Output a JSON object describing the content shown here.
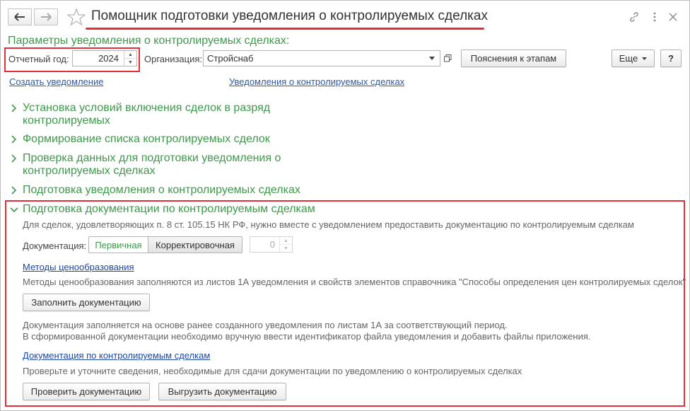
{
  "header": {
    "title": "Помощник подготовки уведомления о контролируемых сделках",
    "back_icon": "arrow-left-icon",
    "forward_icon": "arrow-right-icon",
    "favorite_icon": "star-icon",
    "link_icon": "link-icon",
    "more_icon": "ellipsis-vertical-icon",
    "close_icon": "close-icon"
  },
  "params": {
    "section_title": "Параметры уведомления о контролируемых сделках:",
    "year_label": "Отчетный год:",
    "year_value": "2024",
    "org_label": "Организация:",
    "org_value": "Стройснаб",
    "explain_button": "Пояснения к этапам",
    "more_button": "Еще",
    "help_button": "?"
  },
  "links": {
    "create": "Создать уведомление",
    "notifications": "Уведомления о контролируемых сделках"
  },
  "steps": [
    {
      "line1": "Установка условий включения сделок в разряд",
      "line2": "контролируемых"
    },
    {
      "line1": "Формирование списка контролируемых сделок",
      "line2": ""
    },
    {
      "line1": "Проверка данных для подготовки уведомления о",
      "line2": "контролируемых сделках"
    },
    {
      "line1": "Подготовка уведомления о контролируемых сделках",
      "line2": ""
    },
    {
      "line1": "Подготовка документации по контролируемым сделкам",
      "line2": ""
    }
  ],
  "documentation": {
    "intro": "Для сделок, удовлетворяющих п. 8 ст. 105.15 НК РФ, нужно вместе с уведомлением предоставить документацию по контролируемым сделкам",
    "doc_label": "Документация:",
    "primary": "Первичная",
    "corrective": "Корректировочная",
    "correction_number": "0",
    "pricing_link": "Методы ценообразования",
    "pricing_note": "Методы ценообразования заполняются из листов 1А уведомления и свойств элементов справочника \"Способы определения цен контролируемых сделок\"",
    "fill_button": "Заполнить документацию",
    "fill_note_1": "Документация заполняется на основе ранее созданного уведомления по листам 1А за соответствующий период.",
    "fill_note_2": "В сформированной документации необходимо вручную ввести идентификатор файла уведомления и добавить файлы приложения.",
    "docs_link": "Документация по контролируемым сделкам",
    "check_note": "Проверьте и уточните сведения, необходимые для сдачи документации по уведомлению о контролируемых сделках",
    "check_button": "Проверить документацию",
    "export_button": "Выгрузить документацию"
  },
  "colors": {
    "accent_green": "#3d9a4a",
    "highlight_red": "#e2303a",
    "link_blue": "#2b5aa8"
  }
}
